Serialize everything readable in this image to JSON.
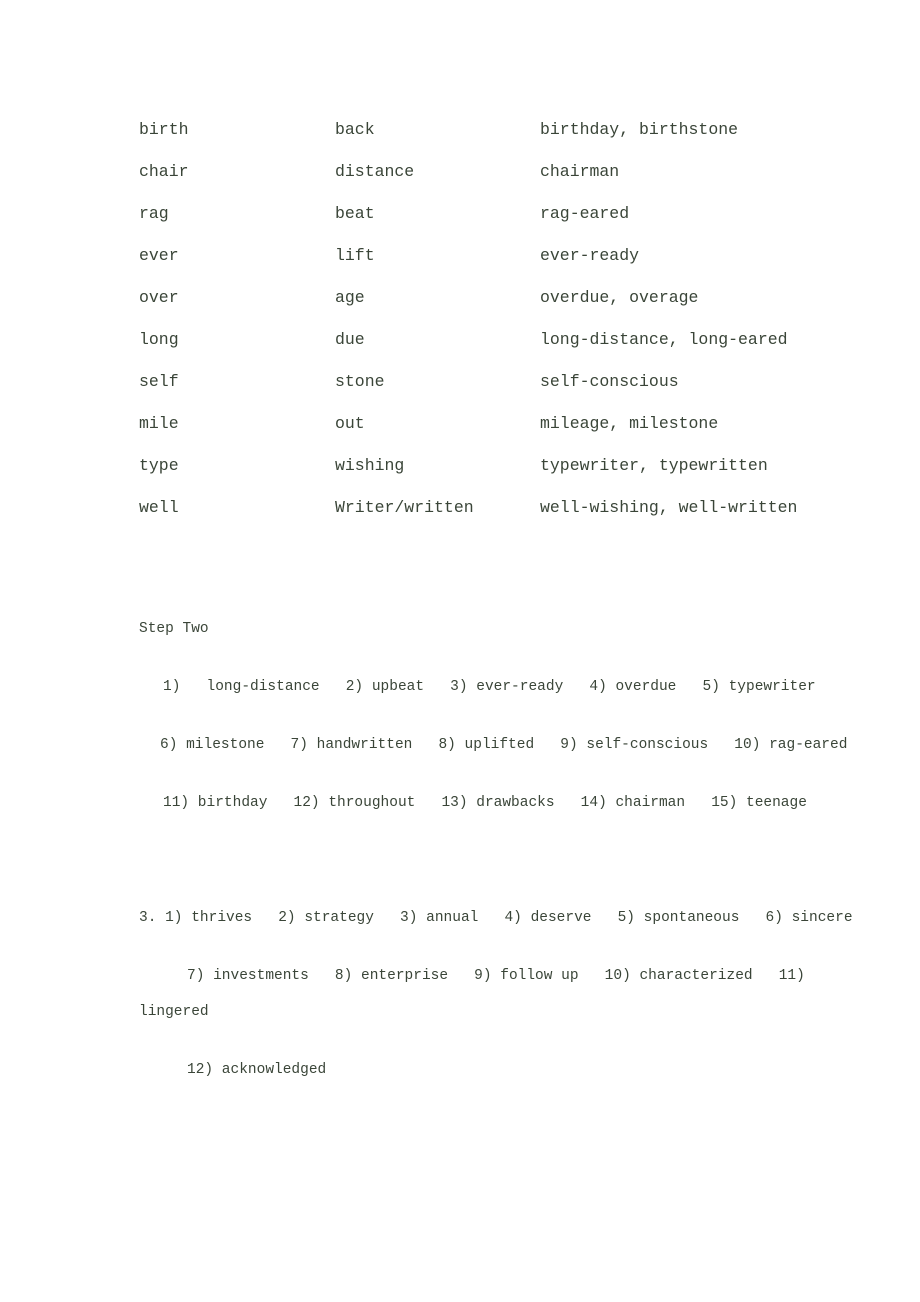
{
  "word_table": {
    "rows": [
      {
        "first": "birth",
        "second": "back",
        "compounds": "birthday, birthstone"
      },
      {
        "first": "chair",
        "second": "distance",
        "compounds": "chairman"
      },
      {
        "first": "rag",
        "second": "beat",
        "compounds": "rag-eared"
      },
      {
        "first": "ever",
        "second": "lift",
        "compounds": "ever-ready"
      },
      {
        "first": "over",
        "second": "age",
        "compounds": "overdue, overage"
      },
      {
        "first": "long",
        "second": "due",
        "compounds": "long-distance, long-eared"
      },
      {
        "first": "self",
        "second": "stone",
        "compounds": "self-conscious"
      },
      {
        "first": "mile",
        "second": "out",
        "compounds": "mileage, milestone"
      },
      {
        "first": "type",
        "second": "wishing",
        "compounds": "typewriter, typewritten"
      },
      {
        "first": "well",
        "second": "Writer/written",
        "compounds": "well-wishing, well-written"
      }
    ]
  },
  "step_two": {
    "title": "Step Two",
    "lines": [
      "1)   long-distance   2) upbeat   3) ever-ready   4) overdue   5) typewriter",
      "6) milestone   7) handwritten   8) uplifted   9) self-conscious   10) rag-eared",
      "11) birthday   12) throughout   13) drawbacks   14) chairman   15) teenage"
    ]
  },
  "section_three": {
    "lines": [
      "3. 1) thrives   2) strategy   3) annual   4) deserve   5) spontaneous   6) sincere",
      "7) investments   8) enterprise   9) follow up   10) characterized   11)",
      "lingered",
      "12) acknowledged"
    ]
  }
}
